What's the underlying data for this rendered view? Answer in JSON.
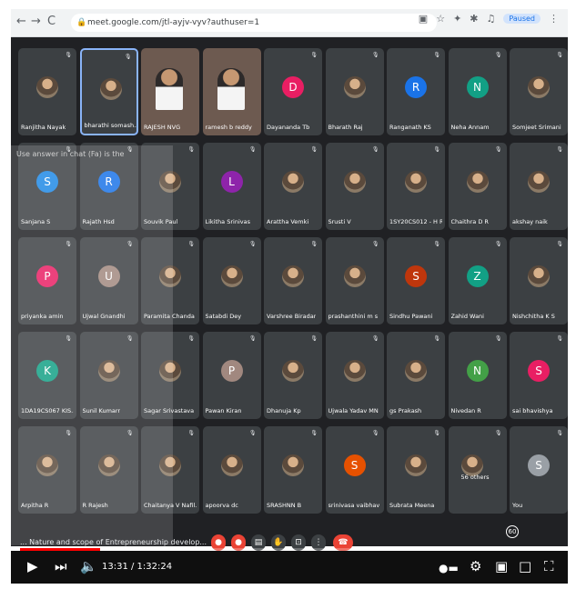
{
  "browser": {
    "url": "meet.google.com/jtl-ayjv-vyv?authuser=1",
    "profile_label": "Paused",
    "nav_back": "←",
    "nav_forward": "→",
    "nav_reload": "C"
  },
  "meet": {
    "participants": [
      {
        "name": "Ranjitha Nayak",
        "kind": "photo"
      },
      {
        "name": "bharathi somash...",
        "kind": "photo",
        "speaking": true
      },
      {
        "name": "RAJESH NVG",
        "kind": "video"
      },
      {
        "name": "ramesh b reddy",
        "kind": "video"
      },
      {
        "name": "Dayananda Tb",
        "kind": "initial",
        "initial": "D",
        "color": "#e91e63"
      },
      {
        "name": "Bharath Raj",
        "kind": "photo"
      },
      {
        "name": "Ranganath KS",
        "kind": "initial",
        "initial": "R",
        "color": "#1a73e8"
      },
      {
        "name": "Neha Annam",
        "kind": "initial",
        "initial": "N",
        "color": "#12a085"
      },
      {
        "name": "Somjeet Srimani",
        "kind": "photo"
      },
      {
        "name": "Sanjana S",
        "kind": "initial",
        "initial": "S",
        "color": "#1e88e5"
      },
      {
        "name": "Rajath Hsd",
        "kind": "initial",
        "initial": "R",
        "color": "#1a73e8"
      },
      {
        "name": "Souvik Paul",
        "kind": "photo"
      },
      {
        "name": "Likitha Srinivas",
        "kind": "initial",
        "initial": "L",
        "color": "#8e24aa"
      },
      {
        "name": "Arattha Vemki",
        "kind": "photo"
      },
      {
        "name": "Srusti V",
        "kind": "photo"
      },
      {
        "name": "1SY20CS012 - H R...",
        "kind": "photo"
      },
      {
        "name": "Chaithra D R",
        "kind": "photo"
      },
      {
        "name": "akshay naik",
        "kind": "photo"
      },
      {
        "name": "priyanka amin",
        "kind": "initial",
        "initial": "P",
        "color": "#e91e63"
      },
      {
        "name": "Ujwal Gnandhi",
        "kind": "initial",
        "initial": "U",
        "color": "#a1887f"
      },
      {
        "name": "Paramita Chanda",
        "kind": "photo"
      },
      {
        "name": "Satabdi Dey",
        "kind": "photo"
      },
      {
        "name": "Varshree Biradar",
        "kind": "photo"
      },
      {
        "name": "prashanthini m s",
        "kind": "photo"
      },
      {
        "name": "Sindhu Pawani",
        "kind": "initial",
        "initial": "S",
        "color": "#bf360c"
      },
      {
        "name": "Zahid Wani",
        "kind": "initial",
        "initial": "Z",
        "color": "#12a085"
      },
      {
        "name": "Nishchitha K S",
        "kind": "photo"
      },
      {
        "name": "1DA19CS067 KIS...",
        "kind": "initial",
        "initial": "K",
        "color": "#12a085"
      },
      {
        "name": "Sunil Kumarr",
        "kind": "photo"
      },
      {
        "name": "Sagar Srivastava",
        "kind": "photo"
      },
      {
        "name": "Pawan Kiran",
        "kind": "initial",
        "initial": "P",
        "color": "#a1887f"
      },
      {
        "name": "Dhanuja Kp",
        "kind": "photo"
      },
      {
        "name": "Ujwala Yadav MN",
        "kind": "photo"
      },
      {
        "name": "gs Prakash",
        "kind": "photo"
      },
      {
        "name": "Nivedan R",
        "kind": "initial",
        "initial": "N",
        "color": "#43a047"
      },
      {
        "name": "sai bhavishya",
        "kind": "initial",
        "initial": "S",
        "color": "#e91e63"
      },
      {
        "name": "Arpitha R",
        "kind": "photo"
      },
      {
        "name": "R Rajesh",
        "kind": "photo"
      },
      {
        "name": "Chaitanya V Nafil...",
        "kind": "photo"
      },
      {
        "name": "apoorva dc",
        "kind": "photo"
      },
      {
        "name": "SRASHNN B",
        "kind": "photo"
      },
      {
        "name": "srinivasa vaibhav",
        "kind": "initial",
        "initial": "S",
        "color": "#e65100"
      },
      {
        "name": "Subrata Meena",
        "kind": "photo"
      },
      {
        "name": "56 others",
        "kind": "others"
      },
      {
        "name": "You",
        "kind": "initial",
        "initial": "S",
        "color": "#9aa0a6"
      }
    ],
    "overlay_text": "Use answer in chat (Fa) is the"
  },
  "player": {
    "title": "... Nature and scope of Entrepreneurship develop...",
    "time_display": "13:31 / 1:32:24",
    "progress_fraction": 0.147,
    "counter_badge": "60"
  },
  "icons": {
    "play": "play-icon",
    "next": "next-icon",
    "volume": "volume-icon",
    "settings": "gear-icon",
    "fullscreen": "fullscreen-icon"
  }
}
